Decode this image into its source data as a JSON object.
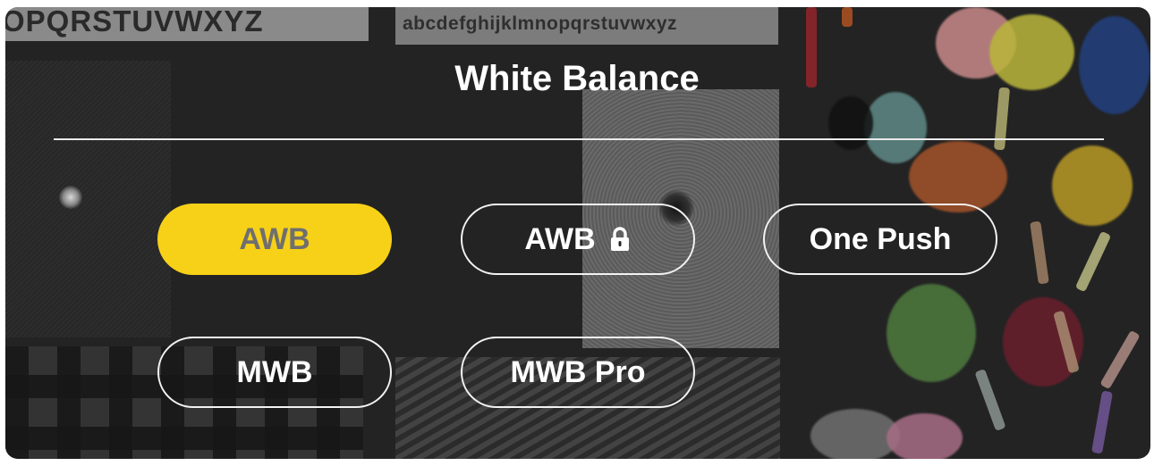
{
  "background": {
    "chart_text_upper": "OPQRSTUVWXYZ",
    "chart_text_lower": "abcdefghijklmnopqrstuvwxyz"
  },
  "panel": {
    "title": "White Balance"
  },
  "modes": [
    {
      "label": "AWB",
      "selected": true
    },
    {
      "label": "AWB",
      "icon": "lock-icon",
      "selected": false
    },
    {
      "label": "One Push",
      "selected": false
    },
    {
      "label": "MWB",
      "selected": false
    },
    {
      "label": "MWB Pro",
      "selected": false
    }
  ],
  "colors": {
    "accent": "#f7d117",
    "selected_text": "#6f6f6f",
    "text": "#ffffff",
    "border": "#f2f2f2"
  }
}
